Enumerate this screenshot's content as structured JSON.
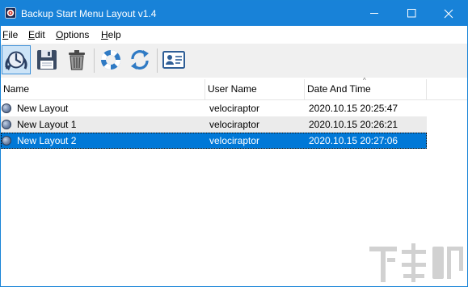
{
  "window": {
    "title": "Backup Start Menu Layout v1.4",
    "accent_color": "#1882d8"
  },
  "menu": [
    {
      "mnemonic": "F",
      "rest": "ile"
    },
    {
      "mnemonic": "E",
      "rest": "dit"
    },
    {
      "mnemonic": "O",
      "rest": "ptions"
    },
    {
      "mnemonic": "H",
      "rest": "elp"
    }
  ],
  "toolbar": {
    "buttons": [
      {
        "icon": "backup-clock-icon",
        "active": true
      },
      {
        "icon": "save-disk-icon"
      },
      {
        "icon": "trash-icon"
      },
      {
        "icon": "lifebuoy-icon"
      },
      {
        "icon": "refresh-icon"
      },
      {
        "icon": "contact-card-icon"
      }
    ]
  },
  "list": {
    "columns": [
      "Name",
      "User Name",
      "Date And Time"
    ],
    "sort_indicator": "^",
    "rows": [
      {
        "name": "New Layout",
        "user": "velociraptor",
        "datetime": "2020.10.15 20:25:47",
        "selected": false
      },
      {
        "name": "New Layout 1",
        "user": "velociraptor",
        "datetime": "2020.10.15 20:26:21",
        "selected": false
      },
      {
        "name": "New Layout 2",
        "user": "velociraptor",
        "datetime": "2020.10.15 20:27:06",
        "selected": true
      }
    ],
    "selected_color": "#0078d7",
    "alt_row_color": "#ebebeb"
  },
  "watermark": {
    "text": "下载吧"
  }
}
